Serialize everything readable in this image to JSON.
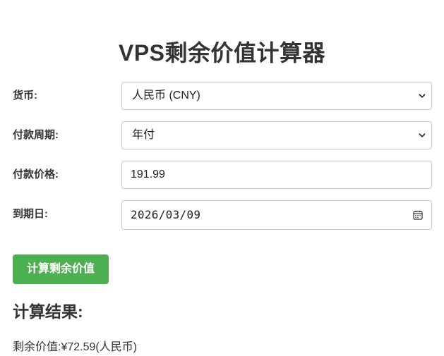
{
  "page": {
    "title": "VPS剩余价值计算器"
  },
  "form": {
    "currency": {
      "label": "货币:",
      "value": "人民币 (CNY)"
    },
    "payment_cycle": {
      "label": "付款周期:",
      "value": "年付"
    },
    "price": {
      "label": "付款价格:",
      "value": "191.99"
    },
    "expiry_date": {
      "label": "到期日:",
      "value": "2026/03/09"
    }
  },
  "actions": {
    "calculate_label": "计算剩余价值"
  },
  "result": {
    "heading": "计算结果:",
    "line": "剩余价值:¥72.59(人民币)"
  },
  "icons": {
    "select_arrow": "chevron-down-icon",
    "date_picker": "calendar-icon"
  },
  "colors": {
    "accent": "#4caf50",
    "text": "#333333",
    "border": "#c8c8c8"
  }
}
